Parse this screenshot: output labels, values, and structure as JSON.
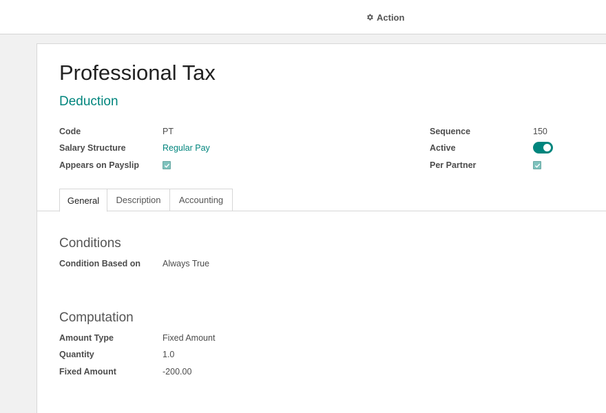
{
  "toolbar": {
    "action_label": "Action",
    "action_icon": "gear-icon"
  },
  "record": {
    "title": "Professional Tax",
    "category": "Deduction"
  },
  "fields_left": {
    "code_label": "Code",
    "code_value": "PT",
    "salary_structure_label": "Salary Structure",
    "salary_structure_value": "Regular Pay",
    "appears_on_payslip_label": "Appears on Payslip",
    "appears_on_payslip_checked": true
  },
  "fields_right": {
    "sequence_label": "Sequence",
    "sequence_value": "150",
    "active_label": "Active",
    "active_on": true,
    "per_partner_label": "Per Partner",
    "per_partner_checked": true
  },
  "tabs": [
    {
      "label": "General",
      "active": true
    },
    {
      "label": "Description",
      "active": false
    },
    {
      "label": "Accounting",
      "active": false
    }
  ],
  "conditions": {
    "title": "Conditions",
    "condition_based_on_label": "Condition Based on",
    "condition_based_on_value": "Always True"
  },
  "computation": {
    "title": "Computation",
    "amount_type_label": "Amount Type",
    "amount_type_value": "Fixed Amount",
    "quantity_label": "Quantity",
    "quantity_value": "1.0",
    "fixed_amount_label": "Fixed Amount",
    "fixed_amount_value": "-200.00"
  },
  "colors": {
    "accent": "#00857d",
    "checkbox": "#7fc2bd"
  }
}
